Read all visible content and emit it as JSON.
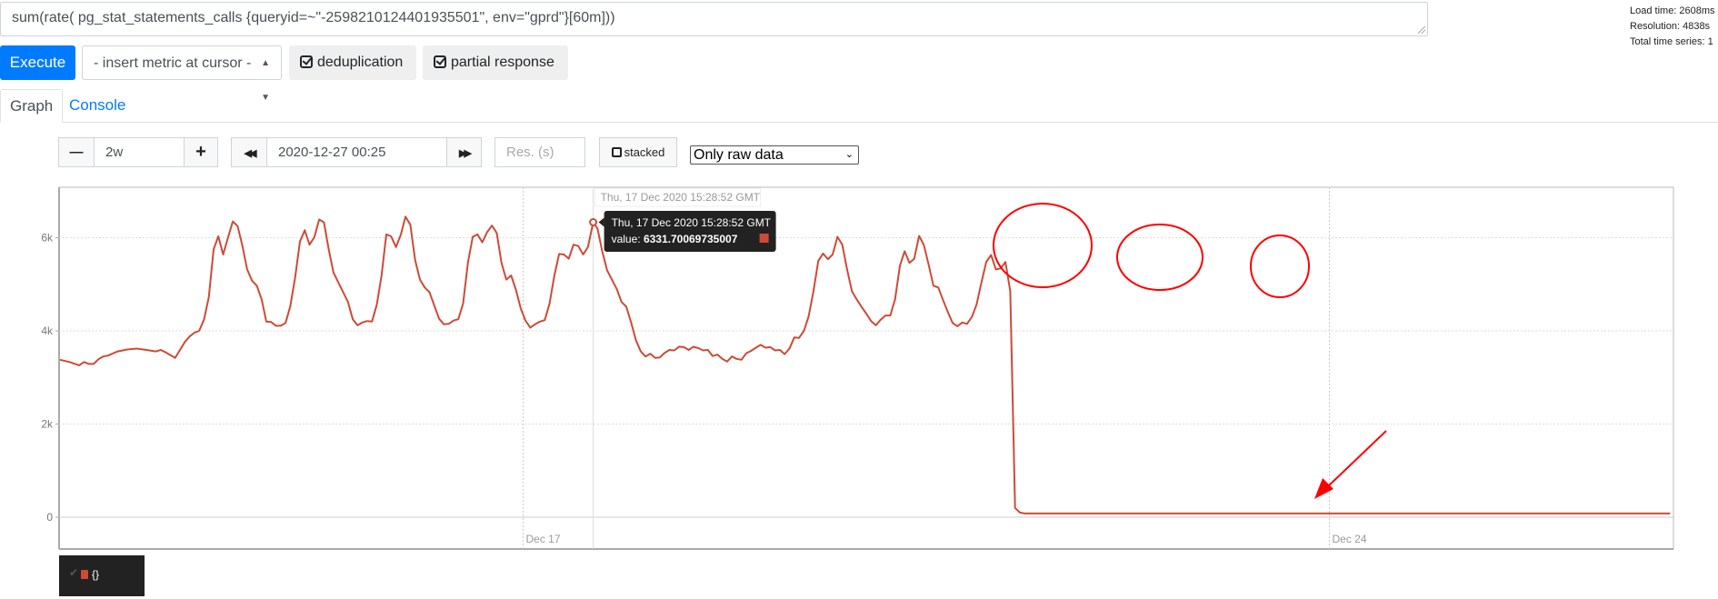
{
  "query": {
    "expression": "sum(rate( pg_stat_statements_calls {queryid=~\"-2598210124401935501\", env=\"gprd\"}[60m]))"
  },
  "stats": {
    "load_time": "Load time: 2608ms",
    "resolution": "Resolution: 4838s",
    "total_series": "Total time series: 1"
  },
  "toolbar": {
    "execute_label": "Execute",
    "metric_select_label": "- insert metric at cursor -",
    "dedup_label": "deduplication",
    "partial_label": "partial response"
  },
  "tabs": [
    {
      "label": "Graph",
      "active": true
    },
    {
      "label": "Console",
      "active": false
    }
  ],
  "graph_controls": {
    "range_minus": "−",
    "range_value": "2w",
    "range_plus": "+",
    "end_back": "◀◀",
    "end_time": "2020-12-27 00:25",
    "end_forward": "▶▶",
    "resolution_placeholder": "Res. (s)",
    "stacked_label": "stacked",
    "raw_select_value": "Only raw data"
  },
  "tooltip": {
    "x_label": "Thu, 17 Dec 2020 15:28:52 GMT",
    "title": "Thu, 17 Dec 2020 15:28:52 GMT",
    "value_prefix": "value: ",
    "value": "6331.70069735007"
  },
  "legend": {
    "items": [
      {
        "label": "{}",
        "color": "#cc4b37",
        "checked": true
      }
    ]
  },
  "colors": {
    "series": "#cc4b37",
    "annotation": "#ff0000",
    "accent": "#007bff"
  },
  "chart_data": {
    "type": "line",
    "title": "",
    "xlabel": "",
    "ylabel": "",
    "x_unit": "hours since 2020-12-13 00:25",
    "xlim": [
      0,
      336
    ],
    "ylim": [
      -700,
      7000
    ],
    "y_ticks": [
      {
        "value": 0,
        "label": "0"
      },
      {
        "value": 2000,
        "label": "2k"
      },
      {
        "value": 4000,
        "label": "4k"
      },
      {
        "value": 6000,
        "label": "6k"
      }
    ],
    "x_ticks": [
      {
        "value": 96.5,
        "label": "Dec 17"
      },
      {
        "value": 264.5,
        "label": "Dec 24"
      }
    ],
    "grid": true,
    "legend_placement": "bottom-left",
    "hover_point": {
      "x": 111.1,
      "y": 6331.7
    },
    "series": [
      {
        "name": "{}",
        "points": [
          [
            0,
            3380
          ],
          [
            2,
            3330
          ],
          [
            4,
            3260
          ],
          [
            5,
            3330
          ],
          [
            6,
            3290
          ],
          [
            7,
            3290
          ],
          [
            8,
            3390
          ],
          [
            9,
            3450
          ],
          [
            10,
            3470
          ],
          [
            12,
            3560
          ],
          [
            14,
            3600
          ],
          [
            16,
            3620
          ],
          [
            18,
            3590
          ],
          [
            20,
            3560
          ],
          [
            21,
            3590
          ],
          [
            22,
            3540
          ],
          [
            24,
            3420
          ],
          [
            25,
            3590
          ],
          [
            26,
            3760
          ],
          [
            27,
            3880
          ],
          [
            28,
            3960
          ],
          [
            29,
            4000
          ],
          [
            30,
            4240
          ],
          [
            31,
            4720
          ],
          [
            32,
            5750
          ],
          [
            33,
            6030
          ],
          [
            34,
            5640
          ],
          [
            35,
            6000
          ],
          [
            36,
            6350
          ],
          [
            37,
            6250
          ],
          [
            38,
            5830
          ],
          [
            39,
            5320
          ],
          [
            40,
            5080
          ],
          [
            41,
            4970
          ],
          [
            42,
            4680
          ],
          [
            43,
            4200
          ],
          [
            44,
            4190
          ],
          [
            45,
            4110
          ],
          [
            46,
            4110
          ],
          [
            47,
            4170
          ],
          [
            48,
            4530
          ],
          [
            49,
            5150
          ],
          [
            50,
            5920
          ],
          [
            51,
            6160
          ],
          [
            52,
            5850
          ],
          [
            53,
            6010
          ],
          [
            54,
            6390
          ],
          [
            55,
            6330
          ],
          [
            56,
            5740
          ],
          [
            57,
            5250
          ],
          [
            58,
            5040
          ],
          [
            60,
            4620
          ],
          [
            61,
            4250
          ],
          [
            62,
            4120
          ],
          [
            63,
            4180
          ],
          [
            64,
            4210
          ],
          [
            65,
            4200
          ],
          [
            66,
            4560
          ],
          [
            67,
            5180
          ],
          [
            68,
            6070
          ],
          [
            69,
            6030
          ],
          [
            70,
            5800
          ],
          [
            71,
            6060
          ],
          [
            72,
            6450
          ],
          [
            73,
            6280
          ],
          [
            74,
            5520
          ],
          [
            75,
            5100
          ],
          [
            76,
            4930
          ],
          [
            77,
            4830
          ],
          [
            78,
            4540
          ],
          [
            79,
            4260
          ],
          [
            80,
            4140
          ],
          [
            81,
            4150
          ],
          [
            82,
            4220
          ],
          [
            83,
            4250
          ],
          [
            84,
            4590
          ],
          [
            85,
            5470
          ],
          [
            86,
            6020
          ],
          [
            87,
            6070
          ],
          [
            88,
            5900
          ],
          [
            89,
            6120
          ],
          [
            90,
            6260
          ],
          [
            91,
            6100
          ],
          [
            92,
            5460
          ],
          [
            93,
            5100
          ],
          [
            94,
            5190
          ],
          [
            95,
            4880
          ],
          [
            96,
            4480
          ],
          [
            97,
            4220
          ],
          [
            98,
            4070
          ],
          [
            99,
            4140
          ],
          [
            100,
            4200
          ],
          [
            101,
            4230
          ],
          [
            102,
            4580
          ],
          [
            103,
            5180
          ],
          [
            104,
            5650
          ],
          [
            105,
            5640
          ],
          [
            106,
            5550
          ],
          [
            107,
            5850
          ],
          [
            108,
            5820
          ],
          [
            109,
            5640
          ],
          [
            110,
            5800
          ],
          [
            111.1,
            6332
          ],
          [
            112,
            6200
          ],
          [
            113,
            5700
          ],
          [
            114,
            5300
          ],
          [
            116,
            4900
          ],
          [
            117,
            4620
          ],
          [
            118,
            4520
          ],
          [
            119,
            4180
          ],
          [
            120,
            3800
          ],
          [
            121,
            3560
          ],
          [
            122,
            3450
          ],
          [
            123,
            3510
          ],
          [
            124,
            3420
          ],
          [
            125,
            3430
          ],
          [
            126,
            3530
          ],
          [
            127,
            3590
          ],
          [
            128,
            3580
          ],
          [
            129,
            3660
          ],
          [
            130,
            3650
          ],
          [
            131,
            3590
          ],
          [
            132,
            3660
          ],
          [
            133,
            3630
          ],
          [
            134,
            3580
          ],
          [
            135,
            3590
          ],
          [
            136,
            3460
          ],
          [
            137,
            3490
          ],
          [
            138,
            3400
          ],
          [
            139,
            3340
          ],
          [
            140,
            3450
          ],
          [
            141,
            3400
          ],
          [
            142,
            3380
          ],
          [
            143,
            3520
          ],
          [
            144,
            3570
          ],
          [
            145,
            3640
          ],
          [
            146,
            3700
          ],
          [
            147,
            3640
          ],
          [
            148,
            3650
          ],
          [
            149,
            3580
          ],
          [
            150,
            3590
          ],
          [
            151,
            3500
          ],
          [
            152,
            3620
          ],
          [
            153,
            3860
          ],
          [
            154,
            3850
          ],
          [
            155,
            4000
          ],
          [
            156,
            4310
          ],
          [
            157,
            4850
          ],
          [
            158,
            5500
          ],
          [
            159,
            5660
          ],
          [
            160,
            5540
          ],
          [
            161,
            5640
          ],
          [
            162,
            6020
          ],
          [
            163,
            5850
          ],
          [
            164,
            5320
          ],
          [
            165,
            4850
          ],
          [
            166,
            4680
          ],
          [
            167,
            4520
          ],
          [
            168,
            4370
          ],
          [
            169,
            4210
          ],
          [
            170,
            4120
          ],
          [
            171,
            4240
          ],
          [
            172,
            4330
          ],
          [
            173,
            4330
          ],
          [
            174,
            4680
          ],
          [
            175,
            5400
          ],
          [
            176,
            5710
          ],
          [
            177,
            5460
          ],
          [
            178,
            5550
          ],
          [
            179,
            6040
          ],
          [
            180,
            5840
          ],
          [
            181,
            5420
          ],
          [
            182,
            4970
          ],
          [
            183,
            4930
          ],
          [
            184,
            4660
          ],
          [
            185,
            4400
          ],
          [
            186,
            4170
          ],
          [
            187,
            4100
          ],
          [
            188,
            4180
          ],
          [
            189,
            4150
          ],
          [
            190,
            4300
          ],
          [
            191,
            4570
          ],
          [
            192,
            5040
          ],
          [
            193,
            5480
          ],
          [
            194,
            5630
          ],
          [
            195,
            5320
          ],
          [
            196,
            5340
          ],
          [
            197,
            5480
          ],
          [
            198,
            4850
          ],
          [
            199,
            200
          ],
          [
            200,
            100
          ],
          [
            201,
            80
          ],
          [
            210,
            80
          ],
          [
            220,
            80
          ],
          [
            230,
            80
          ],
          [
            240,
            80
          ],
          [
            250,
            80
          ],
          [
            260,
            80
          ],
          [
            270,
            80
          ],
          [
            280,
            80
          ],
          [
            290,
            80
          ],
          [
            300,
            80
          ],
          [
            310,
            80
          ],
          [
            320,
            80
          ],
          [
            330,
            80
          ],
          [
            335.5,
            80
          ]
        ]
      }
    ]
  }
}
